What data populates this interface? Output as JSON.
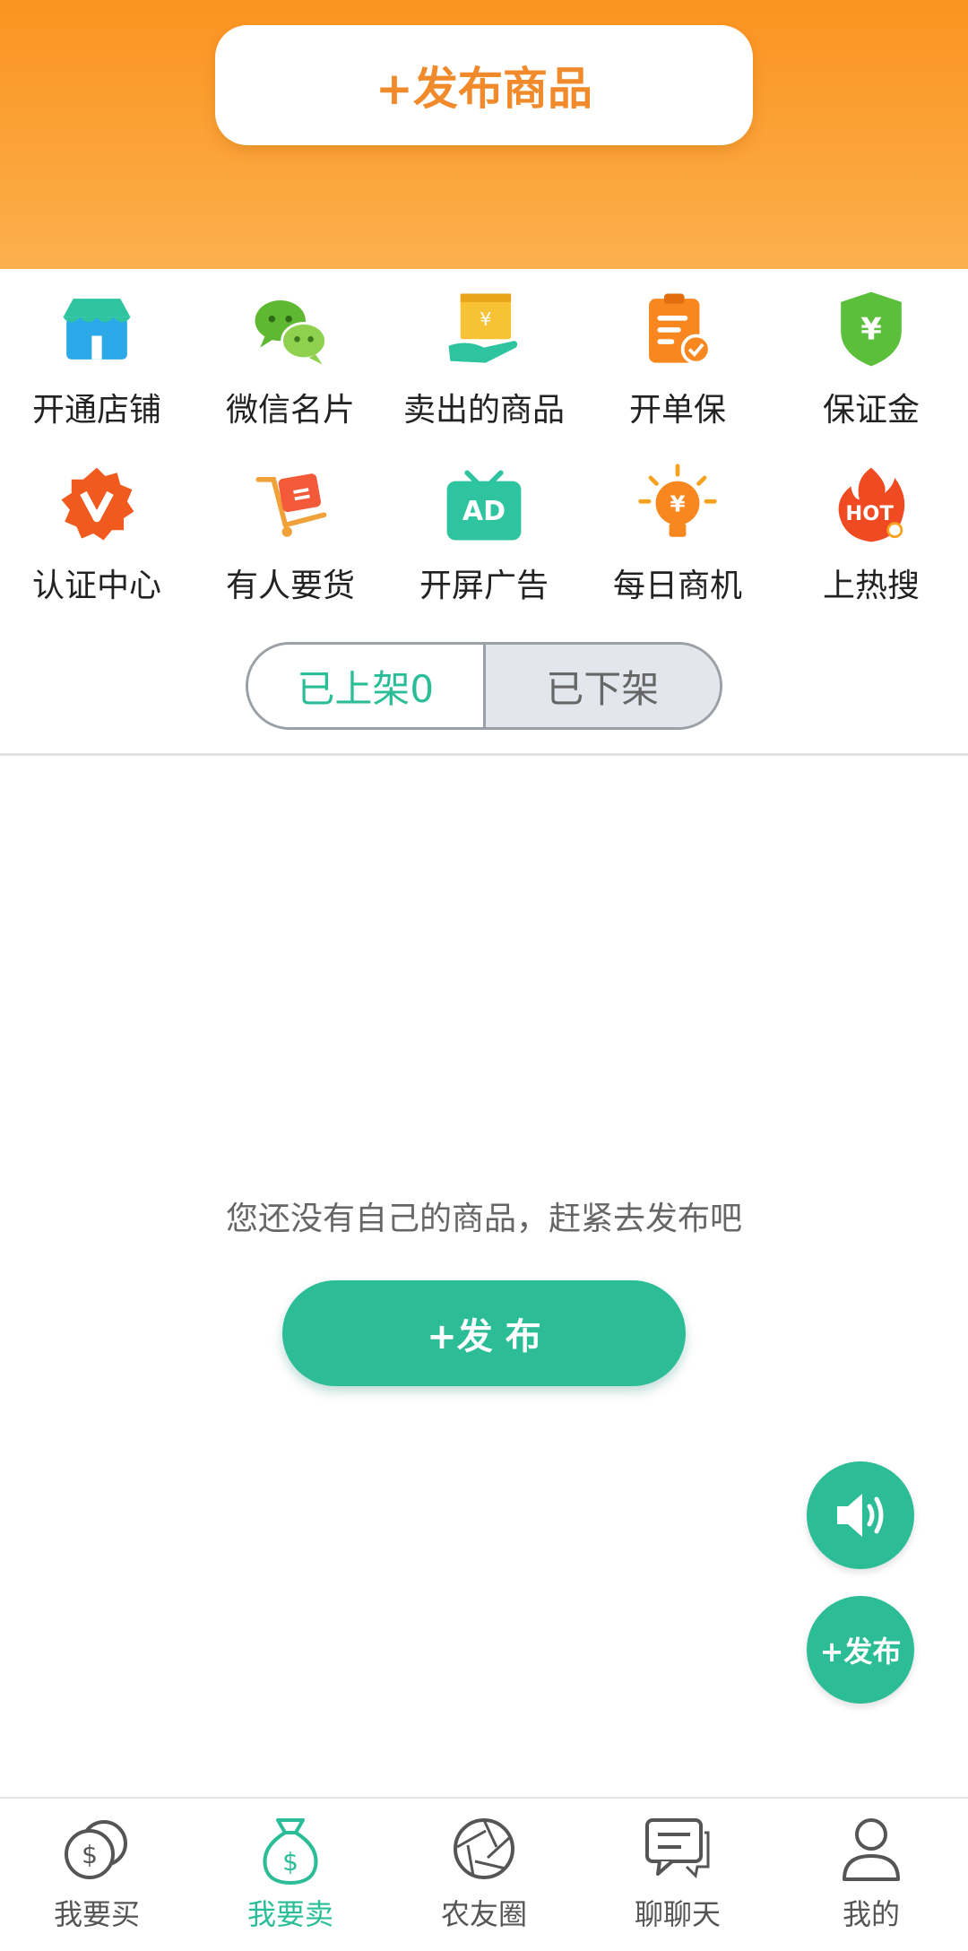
{
  "header": {
    "publish_label": "+发布商品"
  },
  "features": [
    {
      "label": "开通店铺",
      "icon": "store-icon"
    },
    {
      "label": "微信名片",
      "icon": "wechat-icon"
    },
    {
      "label": "卖出的商品",
      "icon": "sold-goods-icon"
    },
    {
      "label": "开单保",
      "icon": "order-insurance-icon"
    },
    {
      "label": "保证金",
      "icon": "deposit-shield-icon"
    },
    {
      "label": "认证中心",
      "icon": "verify-badge-icon"
    },
    {
      "label": "有人要货",
      "icon": "cart-icon"
    },
    {
      "label": "开屏广告",
      "icon": "ad-icon"
    },
    {
      "label": "每日商机",
      "icon": "lightbulb-icon"
    },
    {
      "label": "上热搜",
      "icon": "hot-search-icon"
    }
  ],
  "segment": {
    "listed_label": "已上架0",
    "unlisted_label": "已下架"
  },
  "empty_state": {
    "message": "您还没有自己的商品，赶紧去发布吧",
    "publish_label": "+发 布"
  },
  "fab": {
    "publish_label": "+发布"
  },
  "tabbar": [
    {
      "label": "我要买",
      "icon": "buy-coin-icon",
      "active": false
    },
    {
      "label": "我要卖",
      "icon": "money-bag-icon",
      "active": true
    },
    {
      "label": "农友圈",
      "icon": "aperture-icon",
      "active": false
    },
    {
      "label": "聊聊天",
      "icon": "chat-icon",
      "active": false
    },
    {
      "label": "我的",
      "icon": "user-icon",
      "active": false
    }
  ],
  "colors": {
    "orange": "#fb9420",
    "green": "#2cbd97",
    "active_tab": "#2bbd98"
  }
}
